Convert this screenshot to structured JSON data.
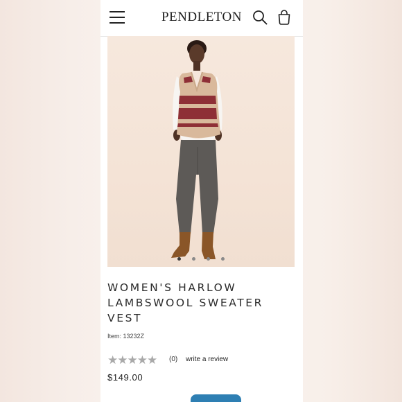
{
  "header": {
    "brand": "PENDLETON",
    "menu_icon": "hamburger-menu-icon",
    "search_icon": "search-icon",
    "bag_icon": "shopping-bag-icon"
  },
  "product": {
    "title": "WOMEN'S HARLOW LAMBSWOOL SWEATER VEST",
    "item_label": "Item:",
    "item_number": "13232Z",
    "rating_count": "(0)",
    "review_link": "write a review",
    "price": "$149.00",
    "stars": "★★★★★",
    "stars_filled": 0,
    "gallery": {
      "total_images": 4,
      "active_index": 0
    }
  },
  "colors": {
    "accent": "#2e7fb3",
    "text": "#2b2b2b",
    "star_empty": "#a9a9a9"
  }
}
